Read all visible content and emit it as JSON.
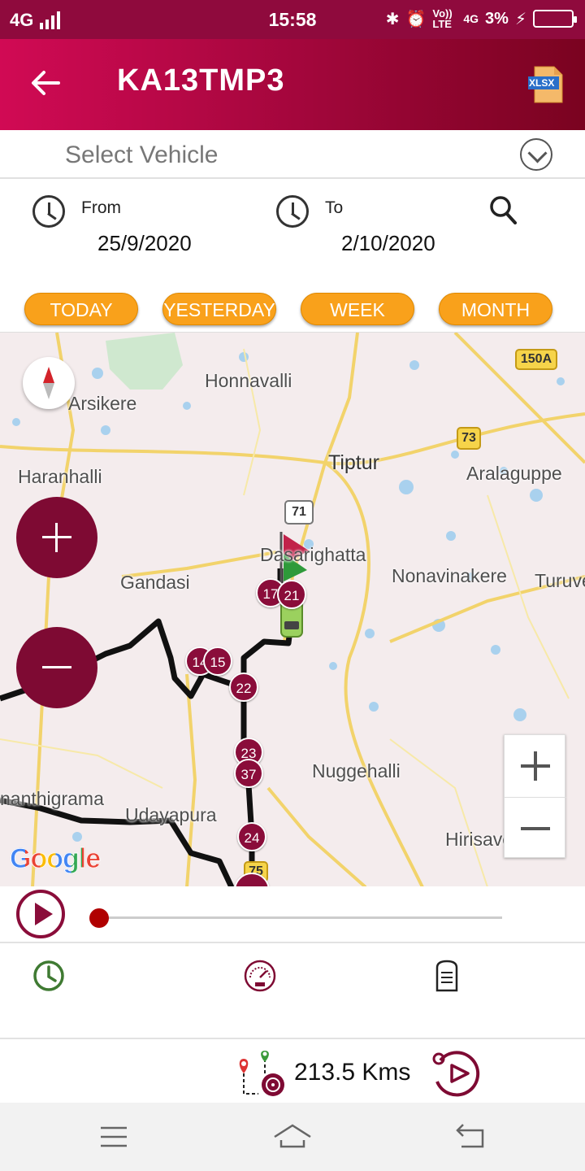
{
  "status_bar": {
    "network": "4G",
    "time": "15:58",
    "lte_label": "Vo)) LTE",
    "network_small": "4G",
    "battery": "3%"
  },
  "header": {
    "title": "KA13TMP3",
    "export_label": "XLSX"
  },
  "vehicle_select": {
    "placeholder": "Select Vehicle"
  },
  "date_range": {
    "from_label": "From",
    "from_value": "25/9/2020",
    "to_label": "To",
    "to_value": "2/10/2020"
  },
  "quick_ranges": [
    "TODAY",
    "YESTERDAY",
    "WEEK",
    "MONTH"
  ],
  "map": {
    "places": [
      "Honnavalli",
      "Arsikere",
      "Tiptur",
      "Haranhalli",
      "Aralaguppe",
      "Gandasi",
      "Dasarighatta",
      "Nonavinakere",
      "Turuve",
      "Nuggehalli",
      "nanthigrama",
      "Udayapura",
      "Hirisave"
    ],
    "road_shields": [
      "150A",
      "73",
      "71",
      "75"
    ],
    "stops": [
      "17",
      "21",
      "14",
      "15",
      "22",
      "23",
      "37",
      "24"
    ],
    "google_logo": "Google"
  },
  "playback": {
    "progress": 0.0
  },
  "summary": {
    "distance": "213.5 Kms"
  },
  "colors": {
    "brand": "#8a0d3a",
    "accent_orange": "#f9a11b",
    "header_start": "#d10a54",
    "header_end": "#7a0320"
  }
}
